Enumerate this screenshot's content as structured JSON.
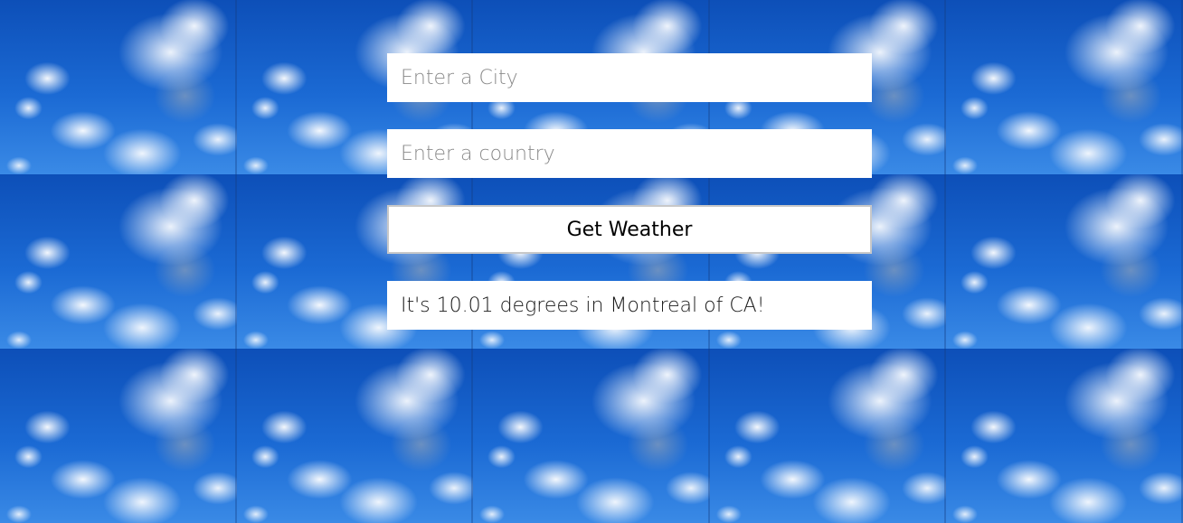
{
  "form": {
    "city_value": "",
    "city_placeholder": "Enter a City",
    "country_value": "",
    "country_placeholder": "Enter a country",
    "submit_label": "Get Weather"
  },
  "result": {
    "message": "It's 10.01 degrees in Montreal of CA!"
  },
  "colors": {
    "sky_blue": "#1565c8",
    "field_bg": "#ffffff",
    "placeholder": "#8a8a8a",
    "button_border": "#c8c8c8"
  }
}
